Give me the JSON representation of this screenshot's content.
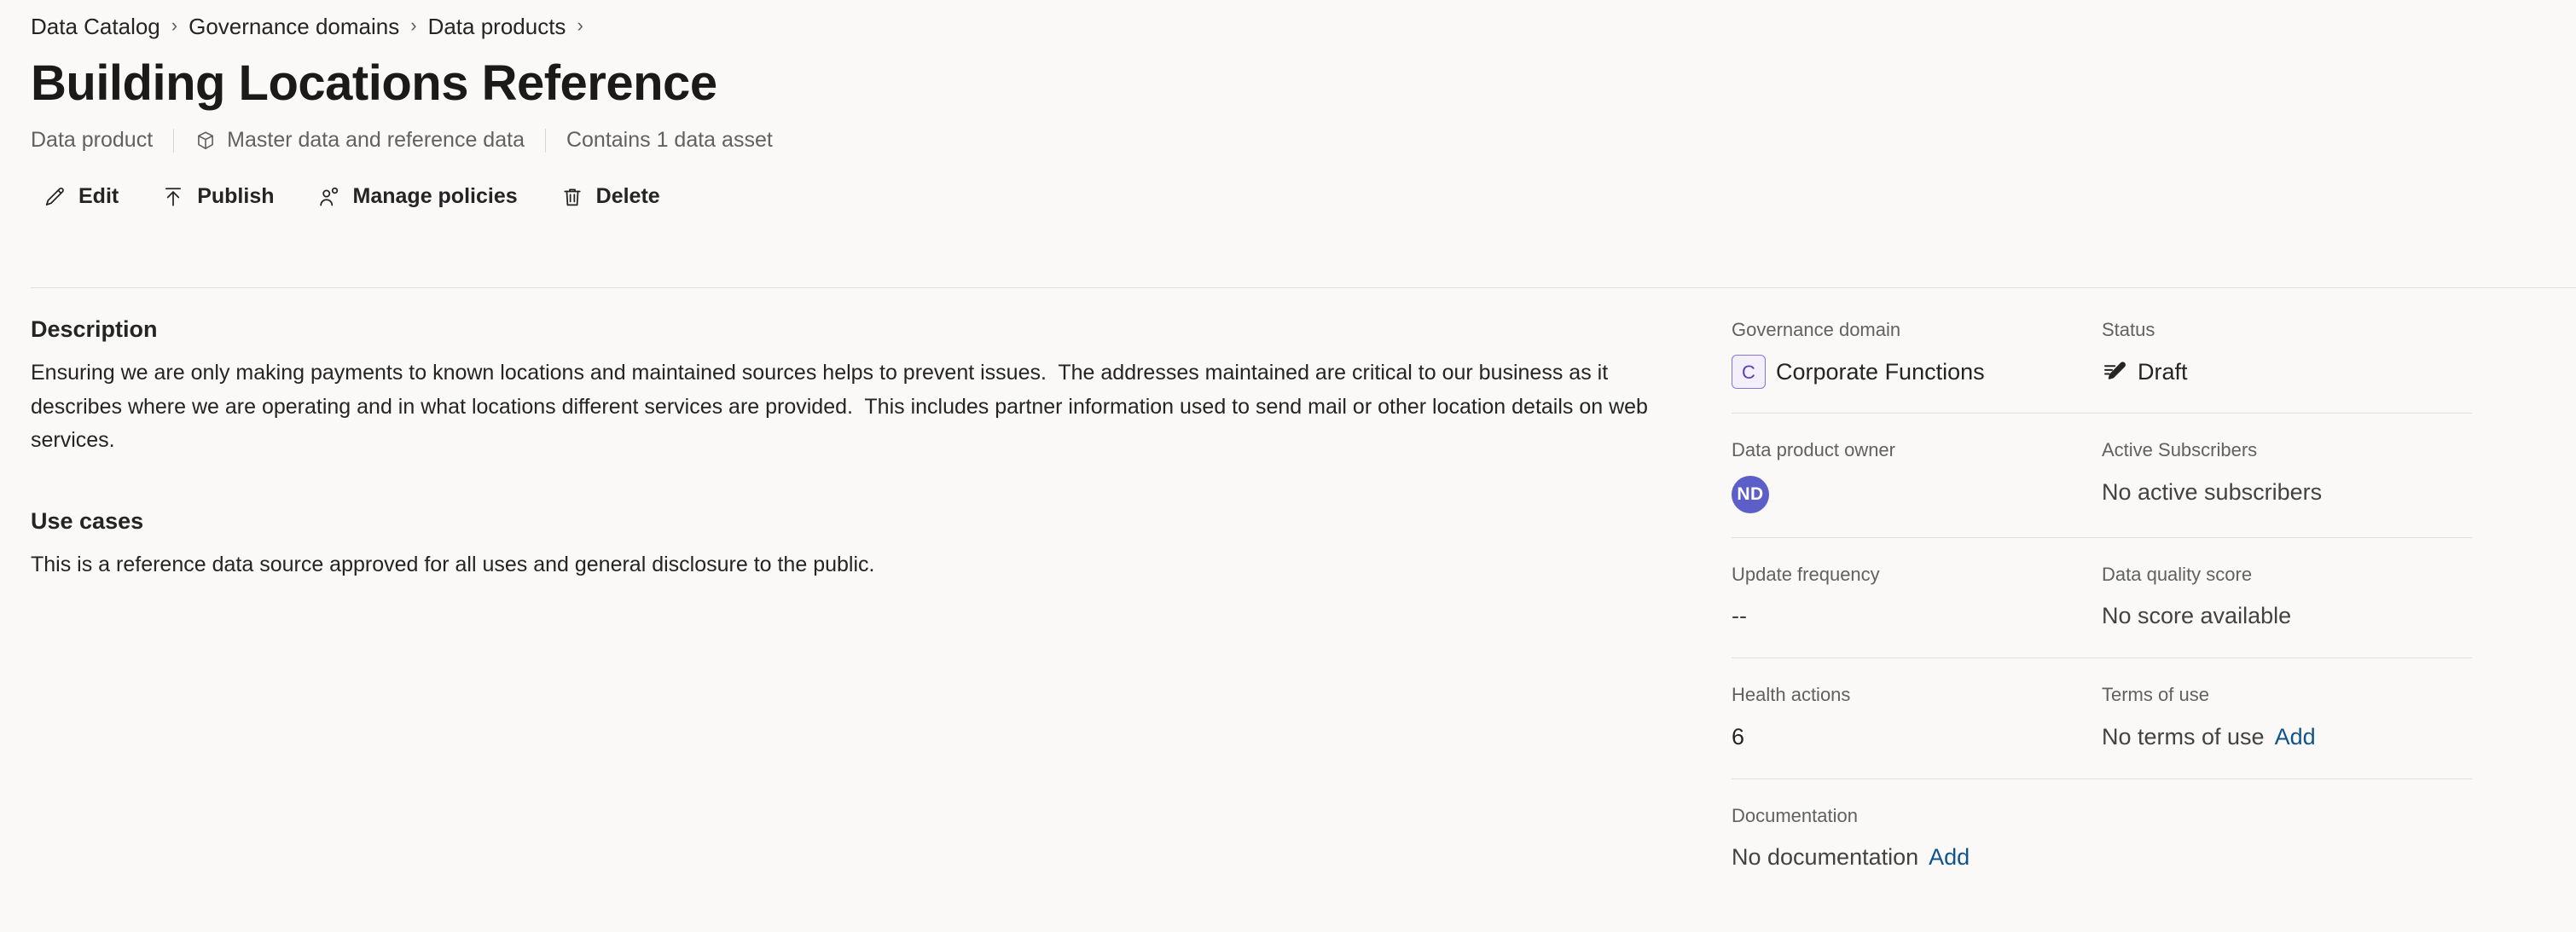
{
  "breadcrumb": {
    "items": [
      {
        "label": "Data Catalog"
      },
      {
        "label": "Governance domains"
      },
      {
        "label": "Data products"
      }
    ],
    "separator": "›"
  },
  "header": {
    "title": "Building Locations Reference",
    "meta": {
      "type_label": "Data product",
      "category_label": "Master data and reference data",
      "category_icon": "package-icon",
      "assets_label": "Contains 1 data asset"
    }
  },
  "toolbar": {
    "buttons": [
      {
        "label": "Edit",
        "icon": "pencil-icon"
      },
      {
        "label": "Publish",
        "icon": "publish-icon"
      },
      {
        "label": "Manage policies",
        "icon": "people-icon"
      },
      {
        "label": "Delete",
        "icon": "trash-icon"
      }
    ]
  },
  "main": {
    "description": {
      "heading": "Description",
      "text": "Ensuring we are only making payments to known locations and maintained sources helps to prevent issues.  The addresses maintained are critical to our business as it describes where we are operating and in what locations different services are provided.  This includes partner information used to send mail or other location details on web services."
    },
    "use_cases": {
      "heading": "Use cases",
      "text": "This is a reference data source approved for all uses and general disclosure to the public."
    }
  },
  "properties": {
    "governance_domain": {
      "label": "Governance domain",
      "badge_initial": "C",
      "value": "Corporate Functions"
    },
    "status": {
      "label": "Status",
      "icon": "draft-pencil-icon",
      "value": "Draft"
    },
    "data_product_owner": {
      "label": "Data product owner",
      "avatar_initials": "ND"
    },
    "active_subscribers": {
      "label": "Active Subscribers",
      "value": "No active subscribers"
    },
    "update_frequency": {
      "label": "Update frequency",
      "value": "--"
    },
    "data_quality_score": {
      "label": "Data quality score",
      "value": "No score available"
    },
    "health_actions": {
      "label": "Health actions",
      "value": "6"
    },
    "terms_of_use": {
      "label": "Terms of use",
      "value": "No terms of use",
      "action_label": "Add"
    },
    "documentation": {
      "label": "Documentation",
      "value": "No documentation",
      "action_label": "Add"
    }
  },
  "colors": {
    "page_background": "#faf9f8",
    "text_primary": "#242424",
    "text_secondary": "#616161",
    "link": "#0f548c",
    "domain_badge_border": "#8a74d8",
    "domain_badge_text": "#5b3fb5",
    "avatar_background": "#5b5fc7",
    "divider": "#e1dfdd"
  }
}
